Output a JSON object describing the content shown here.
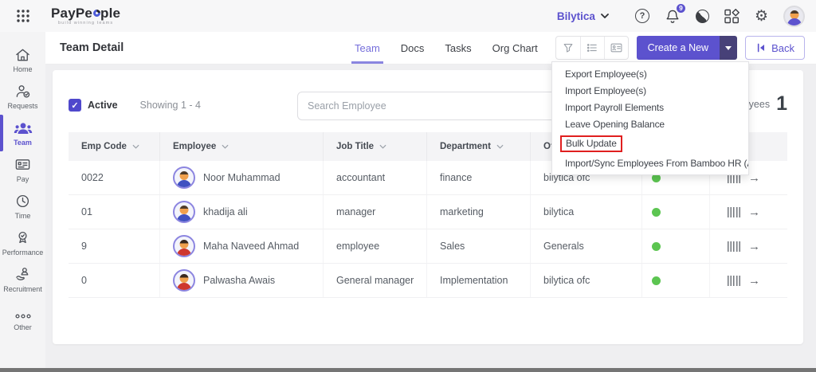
{
  "topbar": {
    "logo_pre": "PayPe",
    "logo_post": "ple",
    "tagline": "build winning teams",
    "org_name": "Bilytica",
    "notification_count": "9"
  },
  "sidebar": {
    "items": [
      {
        "label": "Home"
      },
      {
        "label": "Requests"
      },
      {
        "label": "Team"
      },
      {
        "label": "Pay"
      },
      {
        "label": "Time"
      },
      {
        "label": "Performance"
      },
      {
        "label": "Recruitment"
      },
      {
        "label": "Other"
      }
    ],
    "active_item": "Team"
  },
  "header": {
    "title": "Team Detail",
    "tabs": [
      {
        "label": "Team"
      },
      {
        "label": "Docs"
      },
      {
        "label": "Tasks"
      },
      {
        "label": "Org Chart"
      }
    ],
    "active_tab": "Team",
    "create_button_label": "Create a New",
    "back_label": "Back"
  },
  "filters": {
    "active_label": "Active",
    "active_checked": true,
    "showing_text": "Showing 1 - 4",
    "search_placeholder": "Search Employee",
    "employees_label": "Employees",
    "employees_count": "1"
  },
  "table": {
    "columns": [
      "Emp Code",
      "Employee",
      "Job Title",
      "Department",
      "Office"
    ],
    "rows": [
      {
        "code": "0022",
        "name": "Noor Muhammad",
        "job": "accountant",
        "dept": "finance",
        "office": "bilytica ofc",
        "status": "active",
        "avatar": "male"
      },
      {
        "code": "01",
        "name": "khadija ali",
        "job": "manager",
        "dept": "marketing",
        "office": "bilytica",
        "status": "active",
        "avatar": "male"
      },
      {
        "code": "9",
        "name": "Maha Naveed Ahmad",
        "job": "employee",
        "dept": "Sales",
        "office": "Generals",
        "status": "active",
        "avatar": "female"
      },
      {
        "code": "0",
        "name": "Palwasha Awais",
        "job": "General manager",
        "dept": "Implementation",
        "office": "bilytica ofc",
        "status": "active",
        "avatar": "female"
      }
    ]
  },
  "menu": {
    "items": [
      "Export Employee(s)",
      "Import Employee(s)",
      "Import Payroll Elements",
      "Leave Opening Balance",
      "Bulk Update",
      "Import/Sync Employees From Bamboo HR (API)"
    ],
    "highlighted_item": "Bulk Update"
  },
  "colors": {
    "accent_purple": "#5C52CE",
    "accent_dark_purple": "#474178",
    "status_green": "#5CC551",
    "annotation_red": "#E01F1F"
  }
}
